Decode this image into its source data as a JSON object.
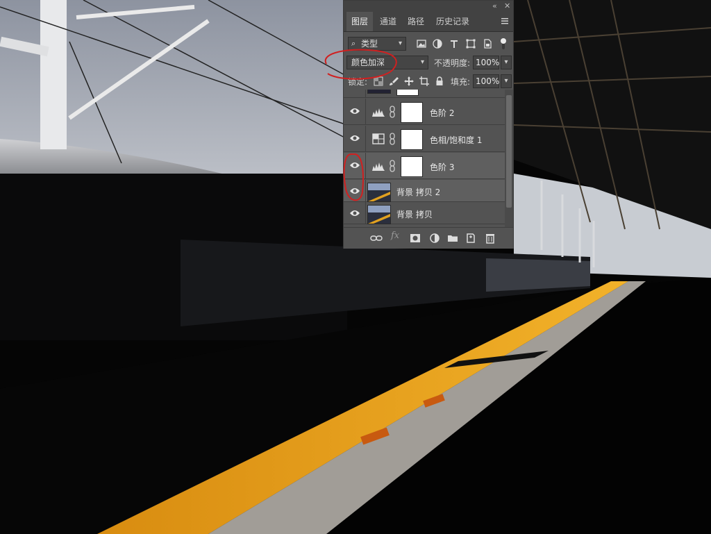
{
  "panel": {
    "tabs": [
      {
        "label": "图层",
        "active": true
      },
      {
        "label": "通道",
        "active": false
      },
      {
        "label": "路径",
        "active": false
      },
      {
        "label": "历史记录",
        "active": false
      }
    ],
    "filter": {
      "kind_label": "类型"
    },
    "blend": {
      "mode": "颜色加深",
      "opacity_label": "不透明度:",
      "opacity_value": "100%"
    },
    "lock": {
      "label": "锁定:",
      "fill_label": "填充:",
      "fill_value": "100%"
    },
    "layers": [
      {
        "name": "色阶 2",
        "type": "levels",
        "visible": true
      },
      {
        "name": "色相/饱和度 1",
        "type": "hue-saturation",
        "visible": true
      },
      {
        "name": "色阶 3",
        "type": "levels",
        "visible": true
      },
      {
        "name": "背景 拷贝 2",
        "type": "image",
        "visible": true
      },
      {
        "name": "背景 拷贝",
        "type": "image",
        "visible": true
      }
    ],
    "footer": {
      "fx_label": "fx"
    }
  },
  "colors": {
    "panel_bg": "#535353",
    "tab_bar": "#424242",
    "annotation_red": "#d02020",
    "platform_yellow": "#e8a01a"
  }
}
